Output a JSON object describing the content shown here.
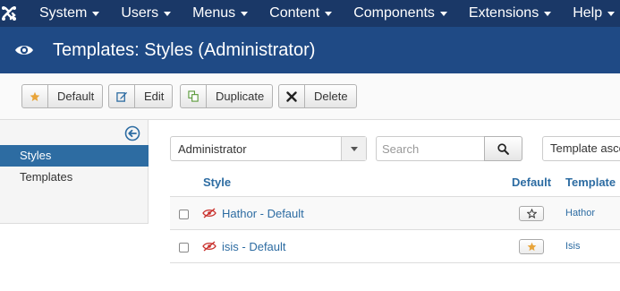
{
  "navbar": {
    "logo_icon": "joomla-logo-icon",
    "items": [
      {
        "label": "System"
      },
      {
        "label": "Users"
      },
      {
        "label": "Menus"
      },
      {
        "label": "Content"
      },
      {
        "label": "Components"
      },
      {
        "label": "Extensions"
      },
      {
        "label": "Help"
      }
    ]
  },
  "titlebar": {
    "icon": "eye-icon",
    "title": "Templates: Styles (Administrator)"
  },
  "toolbar": {
    "default_label": "Default",
    "edit_label": "Edit",
    "duplicate_label": "Duplicate",
    "delete_label": "Delete"
  },
  "sidebar": {
    "items": [
      {
        "label": "Styles",
        "active": true
      },
      {
        "label": "Templates",
        "active": false
      }
    ]
  },
  "filters": {
    "client_value": "Administrator",
    "search_placeholder": "Search",
    "sort_value": "Template ascending"
  },
  "table": {
    "headers": {
      "style": "Style",
      "default": "Default",
      "template": "Template"
    },
    "rows": [
      {
        "style": "Hathor - Default",
        "is_default": false,
        "template": "Hathor"
      },
      {
        "style": "isis - Default",
        "is_default": true,
        "template": "Isis"
      }
    ]
  },
  "colors": {
    "navbar": "#1a3867",
    "titlebar": "#1f4a85",
    "link": "#2d6ca2",
    "active_nav": "#2d6ca2",
    "star": "#e8a43a",
    "hidden_eye": "#c9302c"
  }
}
